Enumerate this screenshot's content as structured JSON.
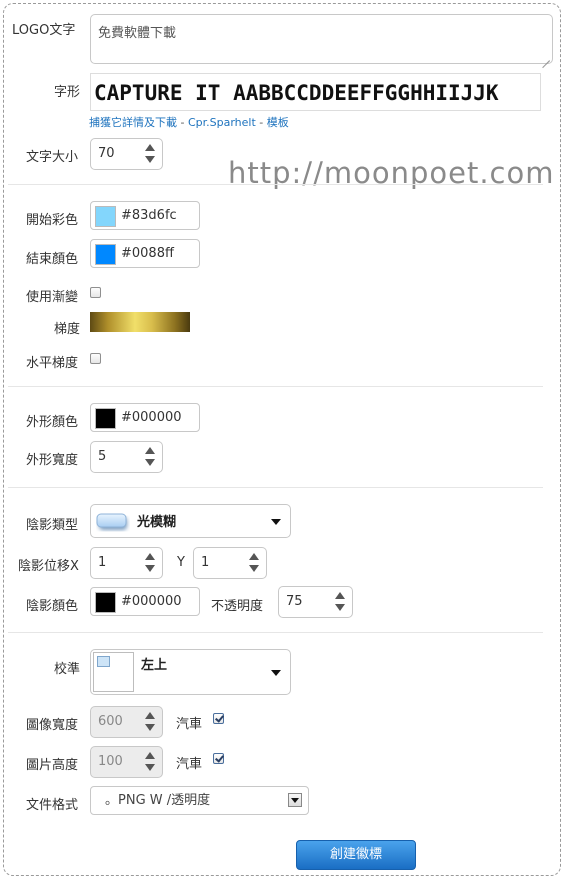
{
  "logo_text": {
    "label": "LOGO文字",
    "value": "免費軟體下載"
  },
  "font": {
    "label": "字形",
    "sample": "CAPTURE IT AABBCCDDEEFFGGHHIIJJK",
    "link1": "捕獲它詳情及下載",
    "sep1": " - ",
    "link2": "Cpr.Sparhelt",
    "sep2": " - ",
    "link3": "模板"
  },
  "text_size": {
    "label": "文字大小",
    "value": "70"
  },
  "watermark": "http://moonpoet.com",
  "start_color": {
    "label": "開始彩色",
    "value": "#83d6fc",
    "swatch": "#83d6fc"
  },
  "end_color": {
    "label": "結束顏色",
    "value": "#0088ff",
    "swatch": "#0088ff"
  },
  "use_gradient": {
    "label": "使用漸變",
    "checked": false
  },
  "gradient": {
    "label": "梯度"
  },
  "horizontal_gradient": {
    "label": "水平梯度",
    "checked": false
  },
  "outline_color": {
    "label": "外形顏色",
    "value": "#000000",
    "swatch": "#000000"
  },
  "outline_width": {
    "label": "外形寬度",
    "value": "5"
  },
  "shadow_type": {
    "label": "陰影類型",
    "value": "光模糊"
  },
  "shadow_offset": {
    "label_x": "陰影位移X",
    "x": "1",
    "label_y": "Y",
    "y": "1"
  },
  "shadow_color": {
    "label": "陰影顏色",
    "value": "#000000",
    "swatch": "#000000"
  },
  "opacity": {
    "label": "不透明度",
    "value": "75"
  },
  "align": {
    "label": "校準",
    "value": "左上"
  },
  "image_width": {
    "label": "圖像寬度",
    "value": "600",
    "auto_label": "汽車",
    "auto_checked": true
  },
  "image_height": {
    "label": "圖片高度",
    "value": "100",
    "auto_label": "汽車",
    "auto_checked": true
  },
  "file_format": {
    "label": "文件格式",
    "value": "。PNG W /透明度"
  },
  "create_button": "創建徽標"
}
